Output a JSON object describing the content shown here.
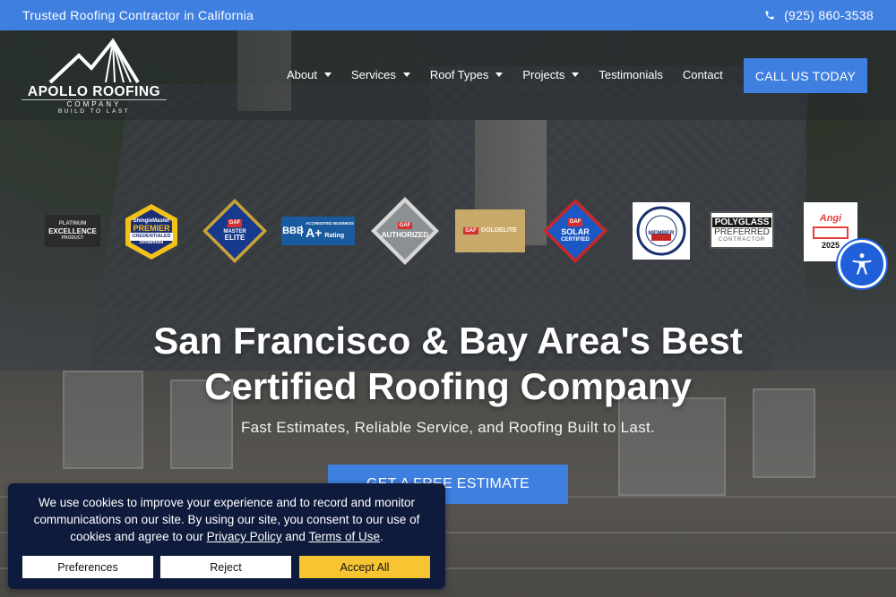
{
  "topbar": {
    "tagline": "Trusted Roofing Contractor in California",
    "phone": "(925) 860-3538",
    "phone_icon": "phone-icon"
  },
  "logo": {
    "name": "APOLLO ROOFING",
    "sub1": "COMPANY",
    "sub2": "BUILD TO LAST",
    "icon": "mountain-roof-icon"
  },
  "nav": {
    "items": [
      {
        "label": "About",
        "dropdown": true
      },
      {
        "label": "Services",
        "dropdown": true
      },
      {
        "label": "Roof Types",
        "dropdown": true
      },
      {
        "label": "Projects",
        "dropdown": true
      },
      {
        "label": "Testimonials",
        "dropdown": false
      },
      {
        "label": "Contact",
        "dropdown": false
      }
    ],
    "cta": "CALL US TODAY"
  },
  "badges": {
    "platinum": {
      "l1": "PLATINUM",
      "l2": "EXCELLENCE",
      "l3": "PRODUCT"
    },
    "shinglemaster": {
      "l1": "ShingleMaster",
      "l2": "PREMIER",
      "l3": "CREDENTIALED",
      "l4": "certainteed"
    },
    "gaf_master": {
      "l1": "GAF",
      "l2": "MASTER",
      "l3": "ELITE"
    },
    "bbb": {
      "l1": "BBB",
      "l2": "ACCREDITED BUSINESS",
      "l3": "A+",
      "l4": "Rating"
    },
    "gaf_authorized": {
      "l1": "GAF",
      "l2": "AUTHORIZED"
    },
    "gaf_goldelite": {
      "l1": "GAF",
      "l2": "GOLDELITE"
    },
    "gaf_solar": {
      "l1": "GAF",
      "l2": "SOLAR",
      "l3": "CERTIFIED"
    },
    "nrca": {
      "l1": "MEMBER"
    },
    "polyglass": {
      "l1": "POLYGLASS",
      "l2": "PREFERRED",
      "l3": "CONTRACTOR"
    },
    "angi": {
      "l1": "Angi",
      "l2": "2025"
    }
  },
  "hero": {
    "title_line1": "San Francisco & Bay Area's Best",
    "title_line2": "Certified Roofing Company",
    "tagline": "Fast Estimates, Reliable Service, and Roofing Built to Last.",
    "cta": "GET A FREE ESTIMATE"
  },
  "accessibility": {
    "icon": "accessibility-icon"
  },
  "cookie": {
    "text_part1": "We use cookies to improve your experience and to record and monitor communications on our site. By using our site, you consent to our use of cookies and agree to our ",
    "privacy_link": "Privacy Policy",
    "and": " and ",
    "terms_link": "Terms of Use",
    "period": ".",
    "preferences": "Preferences",
    "reject": "Reject",
    "accept": "Accept All"
  },
  "colors": {
    "brand_blue": "#3f7fe0",
    "cookie_bg": "#0e1b3c",
    "accept_yellow": "#f7c531"
  }
}
